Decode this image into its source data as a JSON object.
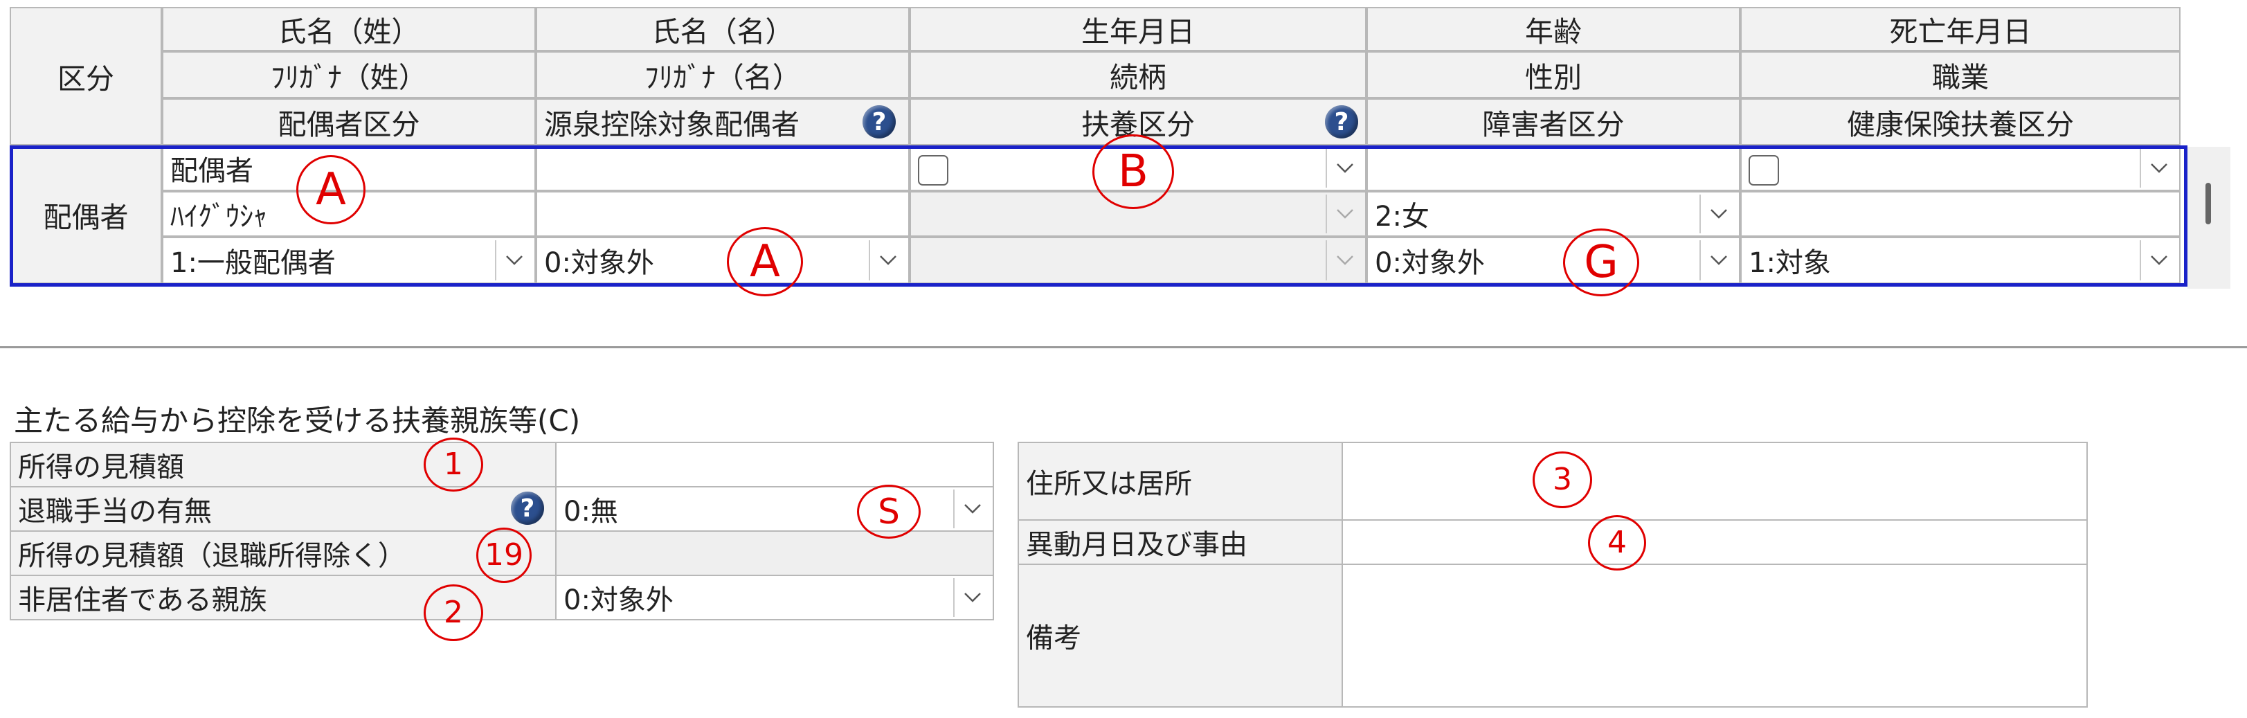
{
  "family_grid": {
    "header_category": "区分",
    "header_rows": [
      [
        "氏名（姓）",
        "氏名（名）",
        "生年月日",
        "年齢",
        "死亡年月日"
      ],
      [
        "ﾌﾘｶﾞﾅ（姓）",
        "ﾌﾘｶﾞﾅ（名）",
        "続柄",
        "性別",
        "職業"
      ],
      [
        "配偶者区分",
        "源泉控除対象配偶者",
        "扶養区分",
        "障害者区分",
        "健康保険扶養区分"
      ]
    ],
    "spouse_row_label": "配偶者",
    "spouse": {
      "last_name": "配偶者",
      "first_name": "",
      "birth_date": "",
      "age": "",
      "death_date": "",
      "last_name_kana": "ﾊｲｸﾞｳｼｬ",
      "first_name_kana": "",
      "relation": "",
      "gender": "2:女",
      "occupation": "",
      "spouse_type": "1:一般配偶者",
      "withholding_spouse": "0:対象外",
      "dependent_type": "",
      "disability_type": "0:対象外",
      "health_insurance_dependent": "1:対象"
    }
  },
  "dependents_section": {
    "title": "主たる給与から控除を受ける扶養親族等(C)",
    "estimated_income_label": "所得の見積額",
    "estimated_income_value": "",
    "retirement_allowance_label": "退職手当の有無",
    "retirement_allowance_value": "0:無",
    "income_excl_retirement_label": "所得の見積額（退職所得除く）",
    "income_excl_retirement_value": "",
    "nonresident_label": "非居住者である親族",
    "nonresident_value": "0:対象外"
  },
  "address_section": {
    "address_label": "住所又は居所",
    "address_value": "",
    "change_label": "異動月日及び事由",
    "change_value": "",
    "remarks_label": "備考",
    "remarks_value": ""
  },
  "annotations": {
    "a1": "A",
    "b": "B",
    "a2": "A",
    "g": "G",
    "s": "S",
    "n1": "1",
    "n2": "2",
    "n3": "3",
    "n4": "4",
    "n19": "19"
  },
  "icons": {
    "help": "?",
    "chevron": "chevron-down-icon"
  },
  "colors": {
    "selection_border": "#1a22c8",
    "annotation": "#e00000",
    "help_icon": "#2c4f8e"
  }
}
